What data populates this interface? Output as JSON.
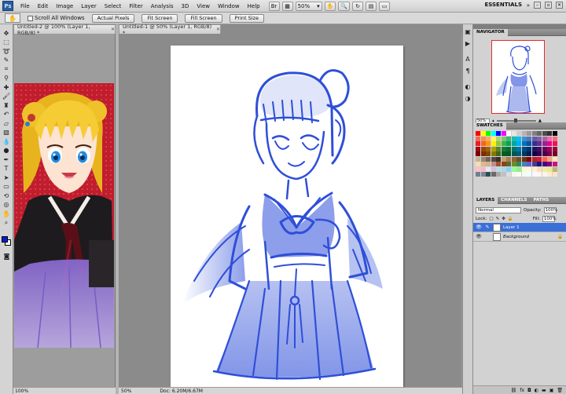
{
  "app": {
    "logo": "Ps",
    "workspace": "ESSENTIALS",
    "zoom_readout": "50%"
  },
  "menu": [
    "File",
    "Edit",
    "Image",
    "Layer",
    "Select",
    "Filter",
    "Analysis",
    "3D",
    "View",
    "Window",
    "Help"
  ],
  "options_bar": {
    "scroll_all_windows": "Scroll All Windows",
    "actual_pixels": "Actual Pixels",
    "fit_screen": "Fit Screen",
    "fill_screen": "Fill Screen",
    "print_size": "Print Size"
  },
  "documents": {
    "doc2": {
      "tab": "Untitled-2 @ 100% (Layer 1, RGB/8) *",
      "zoom": "100%"
    },
    "doc1": {
      "tab": "Untitled-1 @ 50% (Layer 1, RGB/8) *",
      "zoom": "50%",
      "doc_info": "Doc: 6.20M/6.67M"
    }
  },
  "navigator": {
    "title": "NAVIGATOR",
    "zoom": "50%"
  },
  "swatches": {
    "title": "SWATCHES",
    "colors": [
      "#ff0000",
      "#ffff00",
      "#00ff00",
      "#00ffff",
      "#0000ff",
      "#ff00ff",
      "#ffffff",
      "#e6e6e6",
      "#cccccc",
      "#b3b3b3",
      "#999999",
      "#808080",
      "#666666",
      "#4d4d4d",
      "#333333",
      "#000000",
      "#f26c4f",
      "#f68e55",
      "#fbaf5c",
      "#fff467",
      "#acd372",
      "#7cc576",
      "#3bb878",
      "#1abbb4",
      "#00bff3",
      "#438ccb",
      "#5574b9",
      "#605ca8",
      "#855fa8",
      "#a763a8",
      "#f06ea9",
      "#f26d7d",
      "#ed1c24",
      "#f26522",
      "#f7941d",
      "#fff200",
      "#8dc63f",
      "#39b54a",
      "#00a651",
      "#00a99d",
      "#00aeef",
      "#0072bc",
      "#0054a6",
      "#2e3192",
      "#662d91",
      "#92278f",
      "#ec008c",
      "#ed145b",
      "#9e0b0f",
      "#a0410d",
      "#a36209",
      "#aba000",
      "#598527",
      "#1a7b30",
      "#007236",
      "#00746b",
      "#0076a3",
      "#004b80",
      "#003471",
      "#1b1464",
      "#440e62",
      "#630460",
      "#9e005d",
      "#9e0039",
      "#790000",
      "#7b2e00",
      "#7d4900",
      "#827b00",
      "#406618",
      "#005e20",
      "#005826",
      "#005952",
      "#005b7f",
      "#003663",
      "#002157",
      "#0d004c",
      "#32004b",
      "#4b0049",
      "#7b0046",
      "#7a0026",
      "#c7b299",
      "#998675",
      "#736357",
      "#534741",
      "#37302d",
      "#c69c6d",
      "#a67c52",
      "#8c6239",
      "#754c24",
      "#603913",
      "#8b0000",
      "#b22222",
      "#dc143c",
      "#ff6347",
      "#ffa07a",
      "#ffe4b5",
      "#f5deb3",
      "#deb887",
      "#d2b48c",
      "#bc8f8f",
      "#a0522d",
      "#8b4513",
      "#556b2f",
      "#6b8e23",
      "#2e8b57",
      "#4682b4",
      "#6a5acd",
      "#483d8b",
      "#191970",
      "#4b0082",
      "#800080",
      "#c71585",
      "#ffc0cb",
      "#ffb6c1",
      "#e6e6fa",
      "#d8bfd8",
      "#b0e0e6",
      "#add8e6",
      "#87cefa",
      "#98fb98",
      "#90ee90",
      "#fafad2",
      "#fff8dc",
      "#ffefd5",
      "#ffdab9",
      "#eee8aa",
      "#f0e68c",
      "#bdb76b",
      "#708090",
      "#778899",
      "#2f4f4f",
      "#696969",
      "#a9a9a9",
      "#c0c0c0",
      "#dcdcdc",
      "#f5f5f5",
      "#fffaf0",
      "#f0fff0",
      "#f0ffff",
      "#f8f8ff",
      "#fff5ee",
      "#fdf5e6",
      "#faebd7",
      "#ffe4c4"
    ]
  },
  "layers": {
    "tabs": [
      "LAYERS",
      "CHANNELS",
      "PATHS"
    ],
    "blend_mode": "Normal",
    "opacity_label": "Opacity:",
    "opacity": "100%",
    "lock_label": "Lock:",
    "fill_label": "Fill:",
    "fill": "100%",
    "items": [
      {
        "name": "Layer 1",
        "selected": true
      },
      {
        "name": "Background",
        "selected": false
      }
    ]
  },
  "colors": {
    "foreground": "#001fd1",
    "background": "#ffffff",
    "sketch": "#2f4fd8"
  }
}
